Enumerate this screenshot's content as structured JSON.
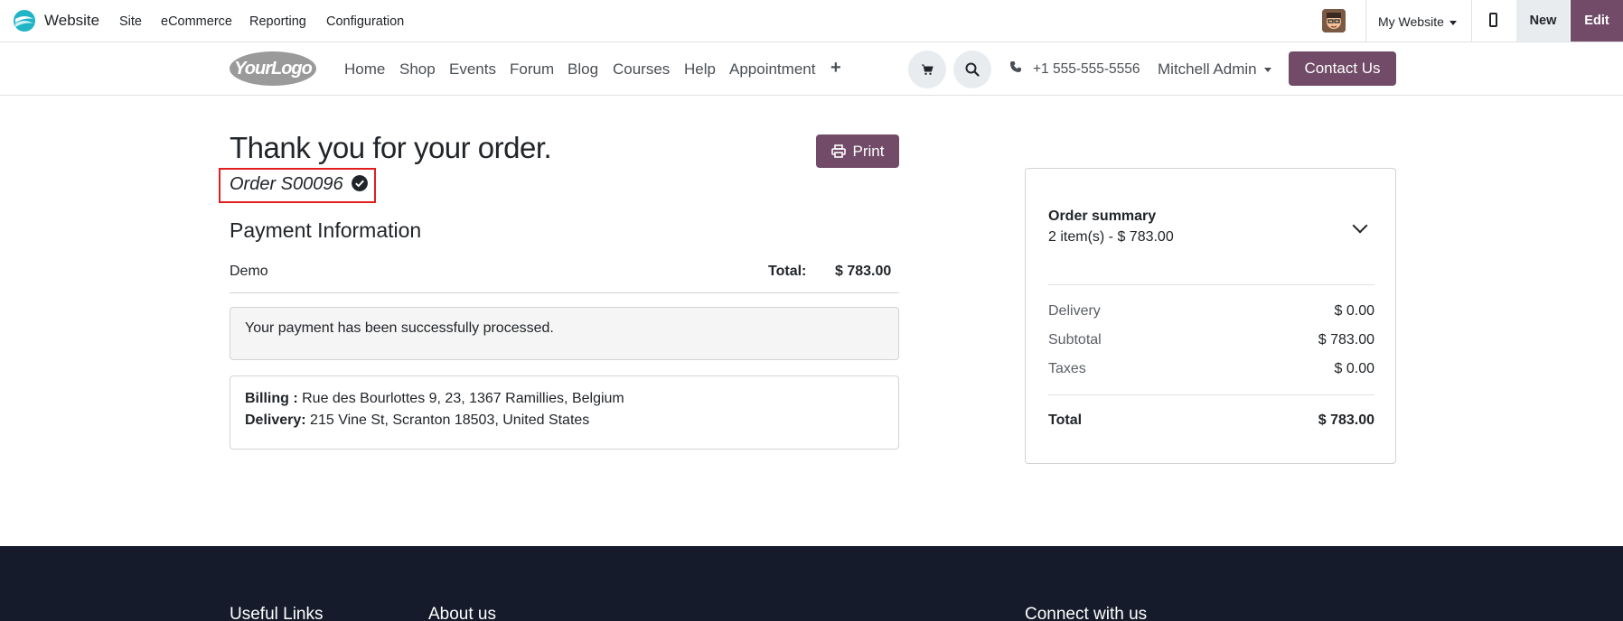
{
  "admin_bar": {
    "app_name": "Website",
    "menu": [
      "Site",
      "eCommerce",
      "Reporting",
      "Configuration"
    ],
    "website_selector": "My Website",
    "new_label": "New",
    "edit_label": "Edit"
  },
  "header": {
    "logo_text": "YourLogo",
    "nav": [
      "Home",
      "Shop",
      "Events",
      "Forum",
      "Blog",
      "Courses",
      "Help",
      "Appointment"
    ],
    "phone": "+1 555-555-5556",
    "user": "Mitchell Admin",
    "contact_label": "Contact Us"
  },
  "main": {
    "title": "Thank you for your order.",
    "print_label": "Print",
    "order_ref": "Order S00096",
    "payment_title": "Payment Information",
    "payment_method": "Demo",
    "total_label": "Total:",
    "total_value": "$ 783.00",
    "alert": "Your payment has been successfully processed.",
    "billing_label": "Billing :",
    "billing_value": "Rue des Bourlottes 9, 23, 1367 Ramillies, Belgium",
    "delivery_label": "Delivery:",
    "delivery_value": "215 Vine St, Scranton 18503, United States"
  },
  "summary": {
    "title": "Order summary",
    "items": "2 item(s) -  $ 783.00",
    "rows": [
      {
        "label": "Delivery",
        "value": "$ 0.00"
      },
      {
        "label": "Subtotal",
        "value": "$ 783.00"
      },
      {
        "label": "Taxes",
        "value": "$ 0.00"
      }
    ],
    "total_label": "Total",
    "total_value": "$ 783.00"
  },
  "footer": {
    "headings": [
      "Useful Links",
      "About us",
      "Connect with us"
    ]
  },
  "colors": {
    "brand": "#714b67",
    "footer_bg": "#151b2b",
    "highlight": "#e01e1e"
  }
}
